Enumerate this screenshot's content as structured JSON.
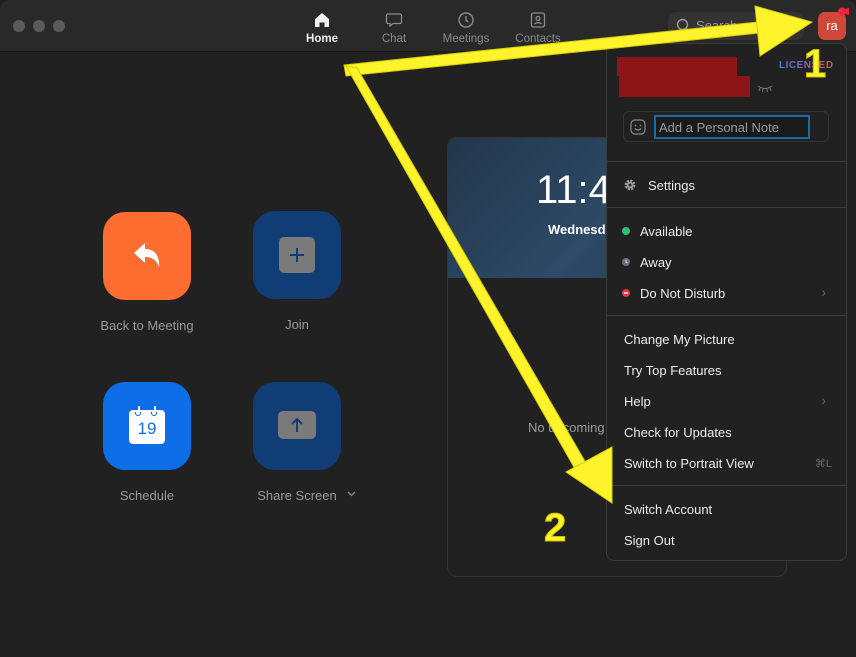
{
  "nav": {
    "tabs": [
      {
        "label": "Home",
        "icon": "home-icon",
        "active": true
      },
      {
        "label": "Chat",
        "icon": "chat-icon",
        "active": false
      },
      {
        "label": "Meetings",
        "icon": "clock-icon",
        "active": false
      },
      {
        "label": "Contacts",
        "icon": "contact-card-icon",
        "active": false
      }
    ],
    "search_placeholder": "Search",
    "avatar_initials": "ra"
  },
  "home": {
    "tiles": [
      {
        "label": "Back to Meeting",
        "icon": "reply-arrow-icon",
        "color": "#fd6d30"
      },
      {
        "label": "Join",
        "icon": "plus-icon",
        "color": "#113d77"
      },
      {
        "label": "Schedule",
        "icon": "calendar-icon",
        "calendar_day": "19",
        "color": "#0e6ee8"
      },
      {
        "label": "Share Screen",
        "icon": "share-up-arrow-icon",
        "color": "#113d77"
      }
    ]
  },
  "clock": {
    "time": "11:4",
    "date": "Wednesd",
    "no_upcoming": "No upcoming"
  },
  "profile_menu": {
    "badge": "LICENSED",
    "note_placeholder": "Add a Personal Note",
    "settings": "Settings",
    "statuses": [
      {
        "label": "Available",
        "color": "#2ec06a"
      },
      {
        "label": "Away",
        "color": "#6e6e80"
      },
      {
        "label": "Do Not Disturb",
        "color": "#e8323c",
        "has_submenu": true
      }
    ],
    "items": [
      {
        "label": "Change My Picture"
      },
      {
        "label": "Try Top Features"
      },
      {
        "label": "Help",
        "has_submenu": true
      },
      {
        "label": "Check for Updates"
      },
      {
        "label": "Switch to Portrait View",
        "shortcut": "⌘L"
      }
    ],
    "account_items": [
      {
        "label": "Switch Account"
      },
      {
        "label": "Sign Out"
      }
    ]
  },
  "annotations": {
    "step1": "1",
    "step2": "2",
    "arrow_color": "#fff32b"
  }
}
